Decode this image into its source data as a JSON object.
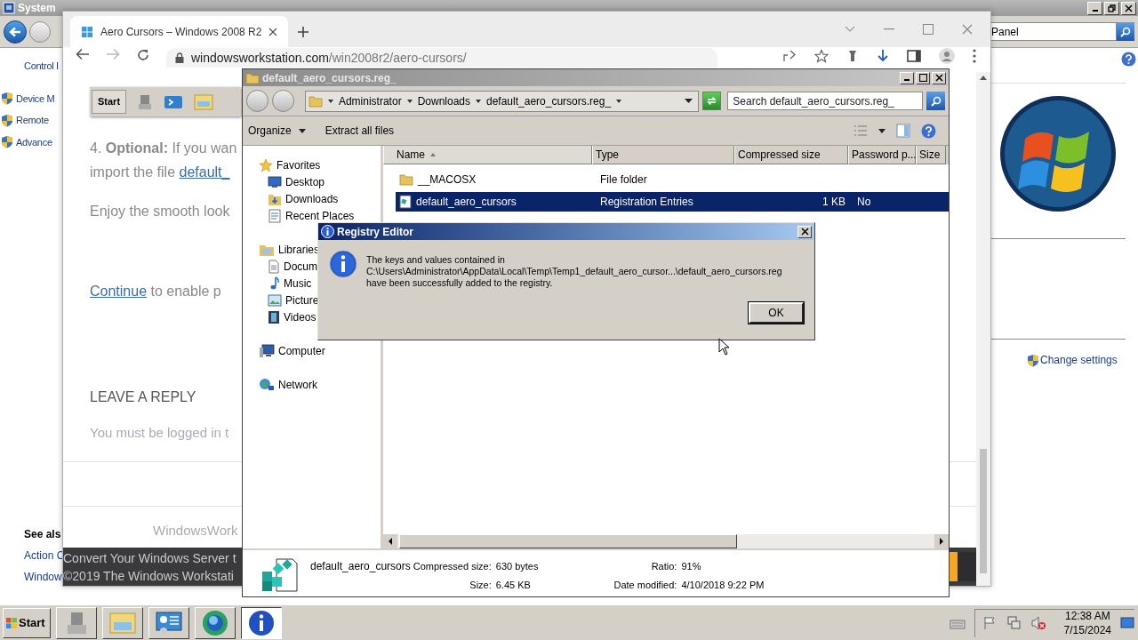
{
  "system_window": {
    "title": "System",
    "search": {
      "value": "Panel"
    },
    "links": [
      "Control I"
    ],
    "tasks": [
      "Device M",
      "Remote",
      "Advance"
    ],
    "see_also": {
      "heading": "See als",
      "links": [
        "Action C",
        "Window"
      ]
    },
    "change_settings": "Change settings"
  },
  "browser": {
    "tabs": [
      {
        "title": "Aero Cursors – Windows 2008 R2",
        "selected": true
      }
    ],
    "url": {
      "host": "windowsworkstation.com",
      "path": "/win2008r2/aero-cursors/"
    },
    "page": {
      "banner_start": "Start",
      "paragraphs": [
        {
          "lines": [
            [
              {
                "text": "4. **Optional:** If you wan"
              }
            ],
            [
              {
                "text": "import the file "
              },
              {
                "text": "default_",
                "link": true
              }
            ]
          ]
        },
        {
          "lines": [
            [
              {
                "text": "Enjoy the smooth look"
              }
            ]
          ]
        },
        {
          "lines": [
            [
              {
                "text": "Continue",
                "link": true
              },
              {
                "text": " to enable p"
              }
            ]
          ]
        }
      ],
      "heading": "LEAVE A REPLY",
      "notice": "You must be logged in t",
      "site_name": "WindowsWork",
      "footer": [
        "Convert Your Windows Server t",
        "©2019 The Windows Workstati"
      ]
    }
  },
  "explorer": {
    "title": "default_aero_cursors.reg_",
    "breadcrumb": [
      "Administrator",
      "Downloads",
      "default_aero_cursors.reg_"
    ],
    "search": {
      "placeholder": "Search default_aero_cursors.reg_"
    },
    "toolbar": [
      {
        "label": "Organize",
        "kind": "menu"
      },
      {
        "label": "Extract all files",
        "kind": "button"
      }
    ],
    "nav": [
      {
        "label": "Favorites",
        "children": [
          {
            "label": "Desktop"
          },
          {
            "label": "Downloads"
          },
          {
            "label": "Recent Places"
          }
        ]
      },
      {
        "label": "Libraries",
        "children": [
          {
            "label": "Docum"
          },
          {
            "label": "Music"
          },
          {
            "label": "Picture"
          },
          {
            "label": "Videos"
          }
        ]
      },
      {
        "label": "Computer"
      },
      {
        "label": "Network"
      }
    ],
    "columns": [
      {
        "label": "Name",
        "sorted": true
      },
      {
        "label": "Type",
        "sorted": false
      },
      {
        "label": "Compressed size",
        "sorted": false
      },
      {
        "label": "Password p...",
        "sorted": false
      },
      {
        "label": "Size",
        "sorted": false
      }
    ],
    "rows": [
      {
        "name": "__MACOSX",
        "type": "File folder",
        "selected": false
      },
      {
        "name": "default_aero_cursors",
        "type": "Registration Entries",
        "compressed_size": "1 KB",
        "password": "No",
        "selected": true
      }
    ],
    "details": {
      "name": "default_aero_cursors",
      "fields": [
        {
          "label": "Compressed size:",
          "value": "630 bytes"
        },
        {
          "label": "Ratio:",
          "value": "91%"
        },
        {
          "label": "Size:",
          "value": "6.45 KB"
        },
        {
          "label": "Date modified:",
          "value": "4/10/2018 9:22 PM"
        }
      ]
    }
  },
  "dialog": {
    "title": "Registry Editor",
    "message": [
      "The keys and values contained in",
      "C:\\Users\\Administrator\\AppData\\Local\\Temp\\Temp1_default_aero_cursor...\\default_aero_cursors.reg",
      "have been successfully added to the registry."
    ],
    "button": "OK"
  },
  "taskbar": {
    "start": "Start",
    "items": [
      {
        "selected": false
      },
      {
        "selected": false
      },
      {
        "selected": false
      },
      {
        "selected": false
      },
      {
        "selected": true
      }
    ],
    "clock": {
      "time": "12:38 AM",
      "date": "7/15/2024"
    }
  }
}
